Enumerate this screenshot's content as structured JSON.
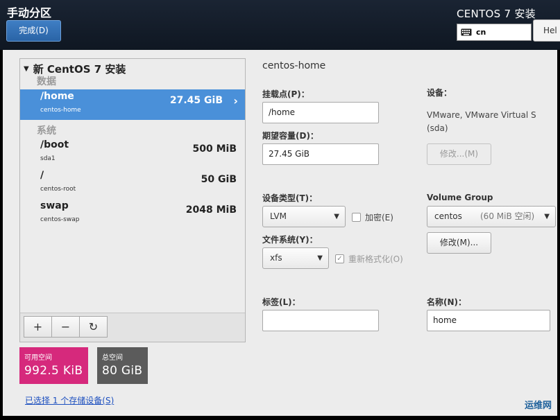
{
  "header": {
    "title": "手动分区",
    "done_label": "完成(D)",
    "os_title": "CENTOS 7 安装",
    "keyboard_layout": "cn",
    "help_label": "Hel"
  },
  "left": {
    "tree_title": "新 CentOS 7 安装",
    "groups": [
      {
        "label": "数据"
      },
      {
        "label": "系统"
      }
    ],
    "partitions": [
      {
        "mount": "/home",
        "device": "centos-home",
        "size": "27.45 GiB",
        "selected": true
      },
      {
        "mount": "/boot",
        "device": "sda1",
        "size": "500 MiB"
      },
      {
        "mount": "/",
        "device": "centos-root",
        "size": "50 GiB"
      },
      {
        "mount": "swap",
        "device": "centos-swap",
        "size": "2048 MiB"
      }
    ],
    "toolbar": {
      "add": "+",
      "remove": "−",
      "refresh": "↻"
    }
  },
  "space": {
    "available_label": "可用空间",
    "available_value": "992.5 KiB",
    "total_label": "总空间",
    "total_value": "80 GiB"
  },
  "storage_link": "已选择 1 个存储设备(S)",
  "detail": {
    "title": "centos-home",
    "mount_point_label": "挂载点(P)：",
    "mount_point_value": "/home",
    "capacity_label": "期望容量(D)：",
    "capacity_value": "27.45 GiB",
    "device_label": "设备：",
    "device_desc_1": "VMware, VMware Virtual S",
    "device_desc_2": "(sda)",
    "modify_device_label": "修改...(M)",
    "device_type_label": "设备类型(T)：",
    "device_type_value": "LVM",
    "encrypt_label": "加密(E)",
    "filesystem_label": "文件系统(Y)：",
    "filesystem_value": "xfs",
    "reformat_label": "重新格式化(O)",
    "volume_group_label": "Volume Group",
    "volume_group_value": "centos",
    "volume_group_free": "(60 MiB 空闲)",
    "modify_vg_label": "修改(M)...",
    "tag_label": "标签(L)：",
    "tag_value": "",
    "name_label": "名称(N)：",
    "name_value": "home"
  },
  "watermark": "运维网"
}
